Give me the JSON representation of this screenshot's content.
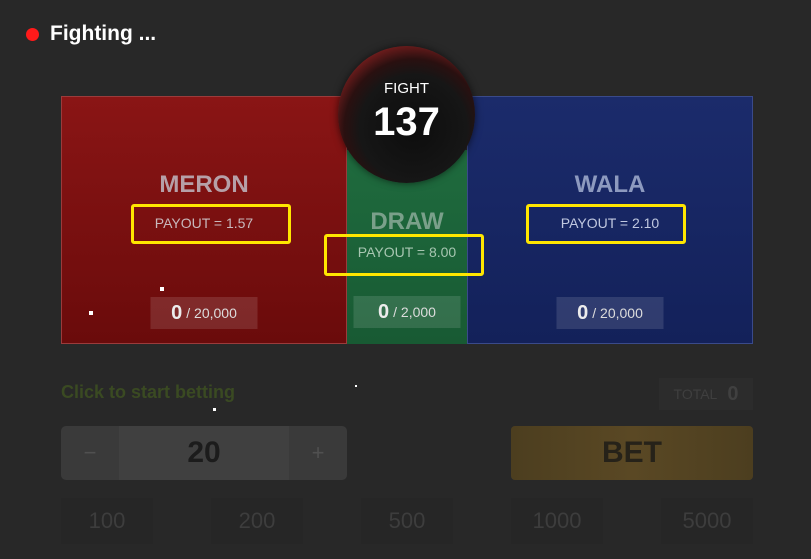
{
  "status": {
    "text": "Fighting ...",
    "color": "#ff1a1a"
  },
  "fight": {
    "label": "FIGHT",
    "number": "137"
  },
  "sides": {
    "meron": {
      "name": "MERON",
      "payout": "PAYOUT = 1.57",
      "amount": "0",
      "limit": "/ 20,000"
    },
    "draw": {
      "name": "DRAW",
      "payout": "PAYOUT = 8.00",
      "amount": "0",
      "limit": "/ 2,000"
    },
    "wala": {
      "name": "WALA",
      "payout": "PAYOUT = 2.10",
      "amount": "0",
      "limit": "/ 20,000"
    }
  },
  "betting": {
    "hint": "Click to start betting",
    "total_label": "TOTAL",
    "total_value": "0",
    "decrement": "−",
    "increment": "+",
    "amount": "20",
    "bet_label": "BET",
    "chips": [
      "100",
      "200",
      "500",
      "1000",
      "5000"
    ]
  },
  "colors": {
    "meron": "#8a1515",
    "draw": "#1f6b3e",
    "wala": "#1b2b6b",
    "highlight": "#ffe600"
  }
}
